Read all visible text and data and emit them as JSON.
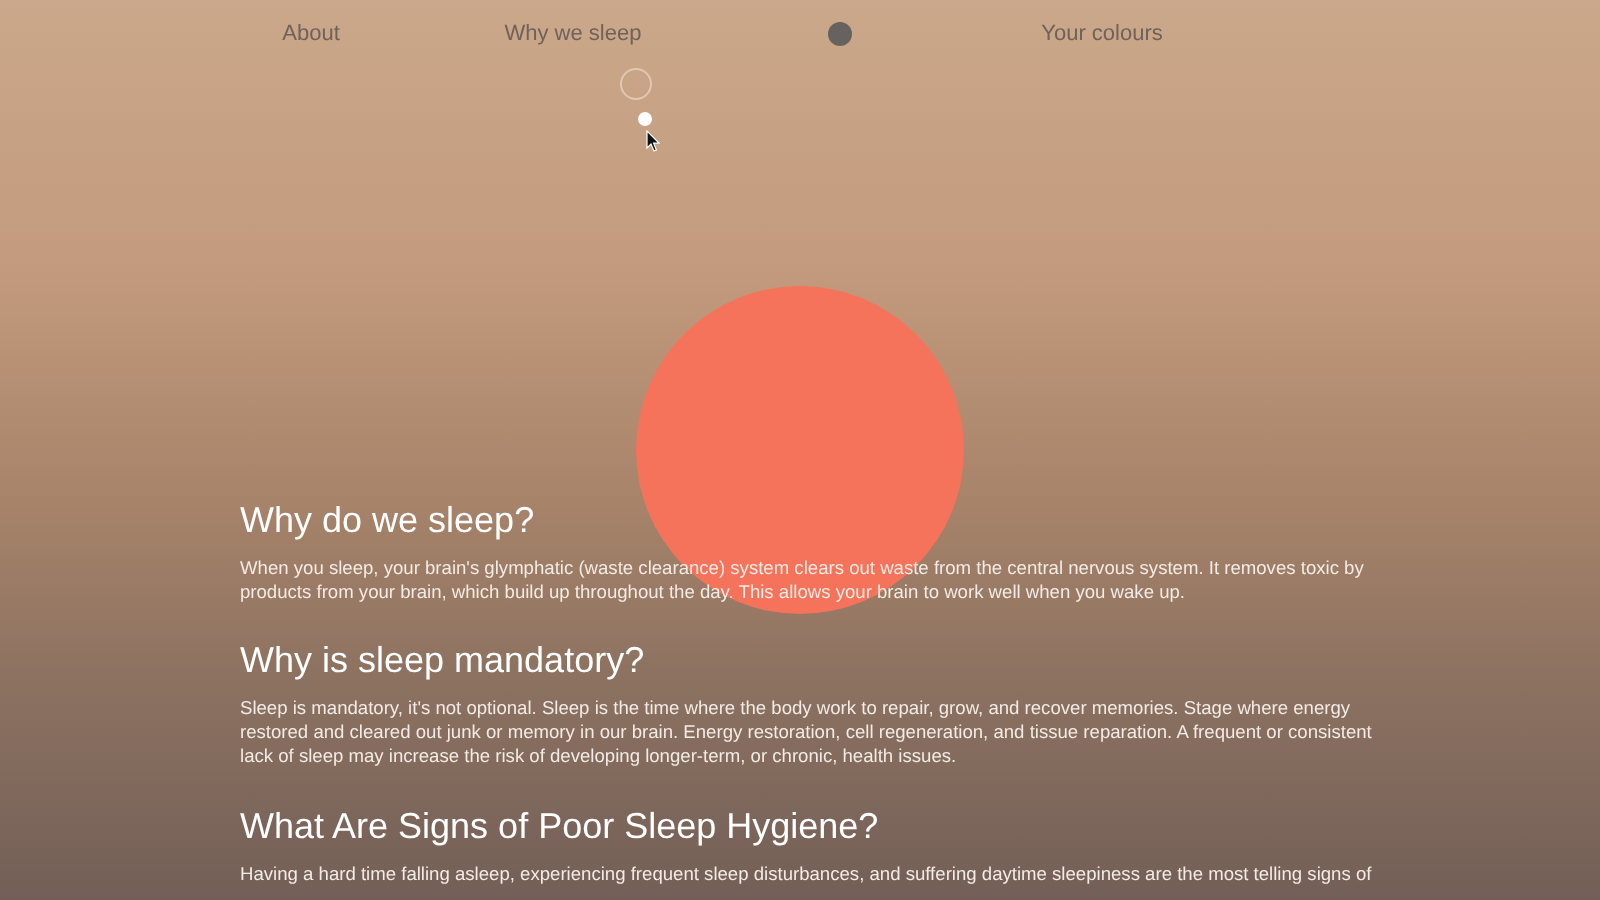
{
  "nav": [
    {
      "kind": "link",
      "label": "About"
    },
    {
      "kind": "link",
      "label": "Why we sleep"
    },
    {
      "kind": "dot"
    },
    {
      "kind": "link",
      "label": "Your colours"
    }
  ],
  "sections": [
    {
      "heading": "Why do we sleep?",
      "text": "When you sleep, your brain's glymphatic (waste clearance) system clears out waste from the central nervous system. It removes toxic by products from your brain, which build up throughout the day. This allows your brain to work well when you wake up."
    },
    {
      "heading": "Why is sleep mandatory?",
      "text": "Sleep is mandatory, it's not optional. Sleep is the time where the body work to repair, grow, and recover memories. Stage where energy restored and cleared out junk or memory in our brain. Energy restoration, cell regeneration, and tissue reparation. A frequent or consistent lack of sleep may increase the risk of developing longer-term, or chronic, health issues."
    },
    {
      "heading": "What Are Signs of Poor Sleep Hygiene?",
      "text": "Having a hard time falling asleep, experiencing frequent sleep disturbances, and suffering daytime sleepiness are the most telling signs of"
    }
  ]
}
